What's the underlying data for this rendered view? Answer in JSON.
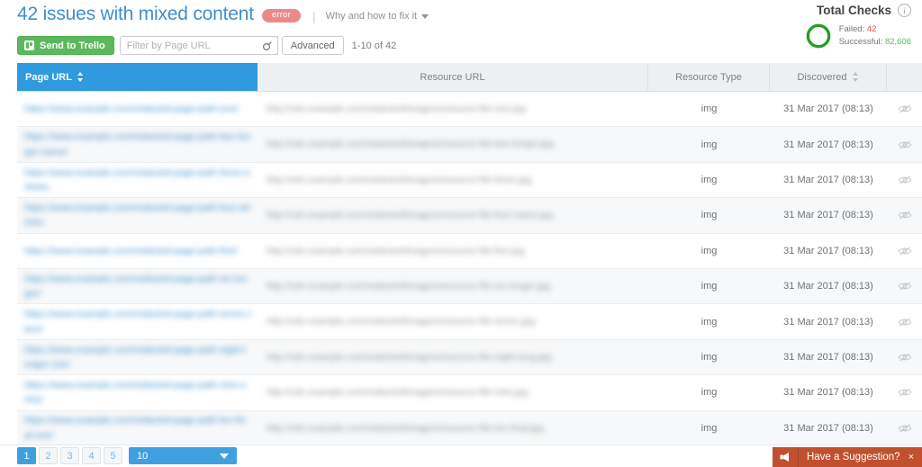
{
  "header": {
    "title": "42 issues with mixed content",
    "badge": "error",
    "separator": "|",
    "help_link": "Why and how to fix it"
  },
  "toolbar": {
    "trello_button": "Send to Trello",
    "filter_placeholder": "Filter by Page URL",
    "filter_value": "",
    "search_icon": "magnifier-icon",
    "advanced_button": "Advanced",
    "range_label": "1-10 of 42"
  },
  "total_checks": {
    "title": "Total Checks",
    "info_icon": "info-icon",
    "failed_label": "Failed:",
    "failed_value": "42",
    "successful_label": "Successful:",
    "successful_value": "82,606",
    "failed_color": "#d9534f",
    "successful_color": "#5cb85c",
    "donut": {
      "failed_pct": 0.05,
      "successful_pct": 99.95
    }
  },
  "table": {
    "columns": [
      {
        "key": "page_url",
        "label": "Page URL",
        "sortable": true,
        "active": true
      },
      {
        "key": "resource_url",
        "label": "Resource URL",
        "sortable": false,
        "active": false
      },
      {
        "key": "resource_type",
        "label": "Resource Type",
        "sortable": false,
        "active": false
      },
      {
        "key": "discovered",
        "label": "Discovered",
        "sortable": true,
        "active": false
      },
      {
        "key": "actions",
        "label": "",
        "sortable": false,
        "active": false
      }
    ],
    "rows": [
      {
        "page_url": "https://www.example.com/redacted-page-path-one/",
        "resource_url": "http://cdn.example.com/redacted/images/resource-file-one.jpg",
        "resource_type": "img",
        "discovered": "31 Mar 2017 (08:13)",
        "action_icon": "eye-slash-icon"
      },
      {
        "page_url": "https://www.example.com/redacted-page-path-two-longer-name/",
        "resource_url": "http://cdn.example.com/redacted/images/resource-file-two-longer.jpg",
        "resource_type": "img",
        "discovered": "31 Mar 2017 (08:13)",
        "action_icon": "eye-slash-icon"
      },
      {
        "page_url": "https://www.example.com/redacted-page-path-three-articles",
        "resource_url": "http://cdn.example.com/redacted/images/resource-file-three.jpg",
        "resource_type": "img",
        "discovered": "31 Mar 2017 (08:13)",
        "action_icon": "eye-slash-icon"
      },
      {
        "page_url": "https://www.example.com/redacted-page-path-four-articles",
        "resource_url": "http://cdn.example.com/redacted/images/resource-file-four-name.jpg",
        "resource_type": "img",
        "discovered": "31 Mar 2017 (08:13)",
        "action_icon": "eye-slash-icon"
      },
      {
        "page_url": "https://www.example.com/redacted-page-path-five/",
        "resource_url": "http://cdn.example.com/redacted/images/resource-file-five.jpg",
        "resource_type": "img",
        "discovered": "31 Mar 2017 (08:13)",
        "action_icon": "eye-slash-icon"
      },
      {
        "page_url": "https://www.example.com/redacted-page-path-six-longer/",
        "resource_url": "http://cdn.example.com/redacted/images/resource-file-six-longer.jpg",
        "resource_type": "img",
        "discovered": "31 Mar 2017 (08:13)",
        "action_icon": "eye-slash-icon"
      },
      {
        "page_url": "https://www.example.com/redacted-page-path-seven-item/",
        "resource_url": "http://cdn.example.com/redacted/images/resource-file-seven.jpg",
        "resource_type": "img",
        "discovered": "31 Mar 2017 (08:13)",
        "action_icon": "eye-slash-icon"
      },
      {
        "page_url": "https://www.example.com/redacted-page-path-eight-longer-one/",
        "resource_url": "http://cdn.example.com/redacted/images/resource-file-eight-long.jpg",
        "resource_type": "img",
        "discovered": "31 Mar 2017 (08:13)",
        "action_icon": "eye-slash-icon"
      },
      {
        "page_url": "https://www.example.com/redacted-page-path-nine-entry/",
        "resource_url": "http://cdn.example.com/redacted/images/resource-file-nine.jpg",
        "resource_type": "img",
        "discovered": "31 Mar 2017 (08:13)",
        "action_icon": "eye-slash-icon"
      },
      {
        "page_url": "https://www.example.com/redacted-page-path-ten-final-one/",
        "resource_url": "http://cdn.example.com/redacted/images/resource-file-ten-final.jpg",
        "resource_type": "img",
        "discovered": "31 Mar 2017 (08:13)",
        "action_icon": "eye-slash-icon"
      }
    ]
  },
  "footer": {
    "pages": [
      "1",
      "2",
      "3",
      "4",
      "5"
    ],
    "current_page": "1",
    "per_page_value": "10",
    "suggestion_label": "Have a Suggestion?",
    "suggestion_icon": "megaphone-icon",
    "suggestion_close": "×"
  },
  "colors": {
    "accent_blue": "#2f9ade",
    "title_blue": "#3e8fcc",
    "error_red": "#ec8a8a",
    "trello_green": "#5cb85c",
    "suggestion_orange": "#c1502e"
  }
}
